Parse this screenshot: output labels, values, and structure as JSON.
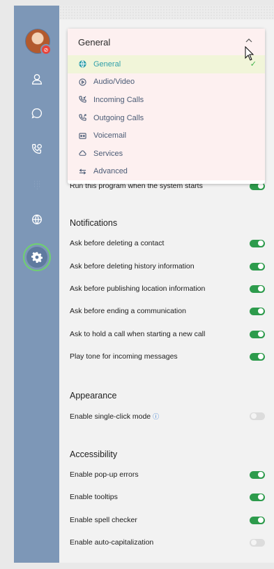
{
  "dropdown": {
    "selected": "General",
    "items": [
      {
        "label": "General",
        "icon": "globe-icon",
        "selected": true
      },
      {
        "label": "Audio/Video",
        "icon": "play-circle-icon"
      },
      {
        "label": "Incoming Calls",
        "icon": "incoming-call-icon"
      },
      {
        "label": "Outgoing Calls",
        "icon": "outgoing-call-icon"
      },
      {
        "label": "Voicemail",
        "icon": "voicemail-icon"
      },
      {
        "label": "Services",
        "icon": "cloud-icon"
      },
      {
        "label": "Advanced",
        "icon": "sliders-icon"
      }
    ]
  },
  "general": {
    "startup_label": "Run this program when the system starts",
    "startup_on": true
  },
  "notifications": {
    "title": "Notifications",
    "items": [
      {
        "label": "Ask before deleting a contact",
        "on": true
      },
      {
        "label": "Ask before deleting history information",
        "on": true
      },
      {
        "label": "Ask before publishing location information",
        "on": true
      },
      {
        "label": "Ask before ending a communication",
        "on": true
      },
      {
        "label": "Ask to hold a call when starting a new call",
        "on": true
      },
      {
        "label": "Play tone for incoming messages",
        "on": true
      }
    ]
  },
  "appearance": {
    "title": "Appearance",
    "items": [
      {
        "label": "Enable single-click mode",
        "on": false,
        "info": true
      }
    ]
  },
  "accessibility": {
    "title": "Accessibility",
    "items": [
      {
        "label": "Enable pop-up errors",
        "on": true
      },
      {
        "label": "Enable tooltips",
        "on": true
      },
      {
        "label": "Enable spell checker",
        "on": true
      },
      {
        "label": "Enable auto-capitalization",
        "on": false
      }
    ]
  },
  "colors": {
    "sidebar": "#7d97b7",
    "toggle_on": "#2d9b4c",
    "toggle_off": "#dcdcdc",
    "active_ring": "#6fd16f"
  }
}
